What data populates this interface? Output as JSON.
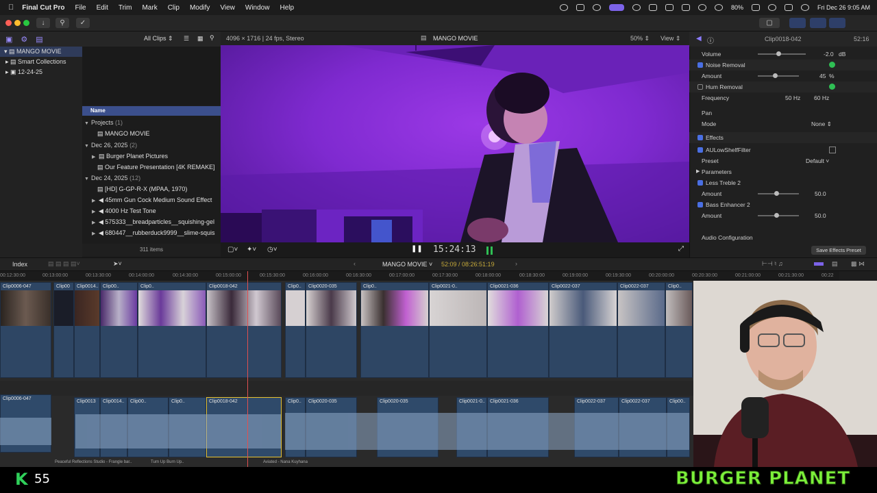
{
  "menubar": {
    "app_name": "Final Cut Pro",
    "items": [
      "File",
      "Edit",
      "Trim",
      "Mark",
      "Clip",
      "Modify",
      "View",
      "Window",
      "Help"
    ],
    "battery": "80%",
    "clock": "Fri Dec 26  9:05 AM"
  },
  "library": {
    "items": [
      {
        "label": "MANGO MOVIE"
      },
      {
        "label": "Smart Collections"
      },
      {
        "label": "12-24-25"
      }
    ]
  },
  "browser": {
    "filter": "All Clips",
    "column_name": "Name",
    "item_count": "311 items",
    "rows": [
      {
        "label": "Projects",
        "count": "(1)",
        "group": true
      },
      {
        "label": "MANGO MOVIE",
        "group": false
      },
      {
        "label": "Dec 26, 2025",
        "count": "(2)",
        "group": true
      },
      {
        "label": "Burger Planet Pictures",
        "group": false
      },
      {
        "label": "Our Feature Presentation [4K REMAKE]",
        "group": false
      },
      {
        "label": "Dec 24, 2025",
        "count": "(12)",
        "group": true
      },
      {
        "label": "[HD] G-GP-R-X (MPAA, 1970)",
        "group": false
      },
      {
        "label": "45mm Gun Cock Medium Sound Effect",
        "group": false
      },
      {
        "label": "4000 Hz Test Tone",
        "group": false
      },
      {
        "label": "575333__breadparticles__squishing-gel",
        "group": false
      },
      {
        "label": "680447__rubberduck9999__slime-squis",
        "group": false
      }
    ]
  },
  "viewer": {
    "format": "4096 × 1716 | 24 fps, Stereo",
    "project": "MANGO MOVIE",
    "zoom": "50%",
    "view": "View",
    "timecode": "15:24:13"
  },
  "inspector": {
    "clip_name": "Clip0018-042",
    "duration": "52:16",
    "volume_label": "Volume",
    "volume_value": "-2.0",
    "volume_unit": "dB",
    "noise_removal": "Noise Removal",
    "amount_label": "Amount",
    "noise_amount": "45",
    "percent": "%",
    "hum_removal": "Hum Removal",
    "frequency_label": "Frequency",
    "freq_50": "50 Hz",
    "freq_60": "60 Hz",
    "pan": "Pan",
    "mode_label": "Mode",
    "mode_value": "None",
    "effects": "Effects",
    "effect1": "AULowShelfFilter",
    "preset_label": "Preset",
    "preset_value": "Default",
    "parameters": "Parameters",
    "effect2": "Less Treble 2",
    "effect2_amount": "50.0",
    "effect3": "Bass Enhancer 2",
    "effect3_amount": "50.0",
    "audio_config": "Audio Configuration",
    "save_preset": "Save Effects Preset"
  },
  "timeline": {
    "index": "Index",
    "project": "MANGO MOVIE",
    "position": "52:09 / 08:26:51:19",
    "ruler": [
      "00:12:30:00",
      "00:13:00:00",
      "00:13:30:00",
      "00:14:00:00",
      "00:14:30:00",
      "00:15:00:00",
      "00:15:30:00",
      "00:16:00:00",
      "00:16:30:00",
      "00:17:00:00",
      "00:17:30:00",
      "00:18:00:00",
      "00:18:30:00",
      "00:19:00:00",
      "00:19:30:00",
      "00:20:00:00",
      "00:20:30:00",
      "00:21:00:00",
      "00:21:30:00",
      "00:22"
    ],
    "video_clips": [
      "Clip0006-047",
      "Clip00",
      "Clip0014..",
      "Clip00..",
      "Clip0..",
      "Clip0018-042",
      "Clip0..",
      "Clip0020-035",
      "Clip0..",
      "Clip0020-035",
      "Clip0021-0..",
      "Clip0021-036",
      "Clip0022-037",
      "Clip0022-037",
      "Clip0029",
      "Clip0.."
    ],
    "audio_clips": [
      "Clip0006-047",
      "Clip0013",
      "Clip0014..",
      "Clip00..",
      "Clip0..",
      "Clip0018-042",
      "Clip0..",
      "Clip0020-035",
      "Clip0020-035",
      "Clip0021-0..",
      "Clip0021-036",
      "Clip0022-037",
      "Clip0022-037",
      "Clip00.."
    ],
    "bottom_labels": [
      "Peaceful Reflections Studio - Frangle bar..",
      "Turn Up Burn Up..",
      "Aviated - Nana Kuyhana"
    ]
  },
  "overlay": {
    "logo_letter": "K",
    "logo_count": "55",
    "banner": "BURGER PLANET"
  }
}
